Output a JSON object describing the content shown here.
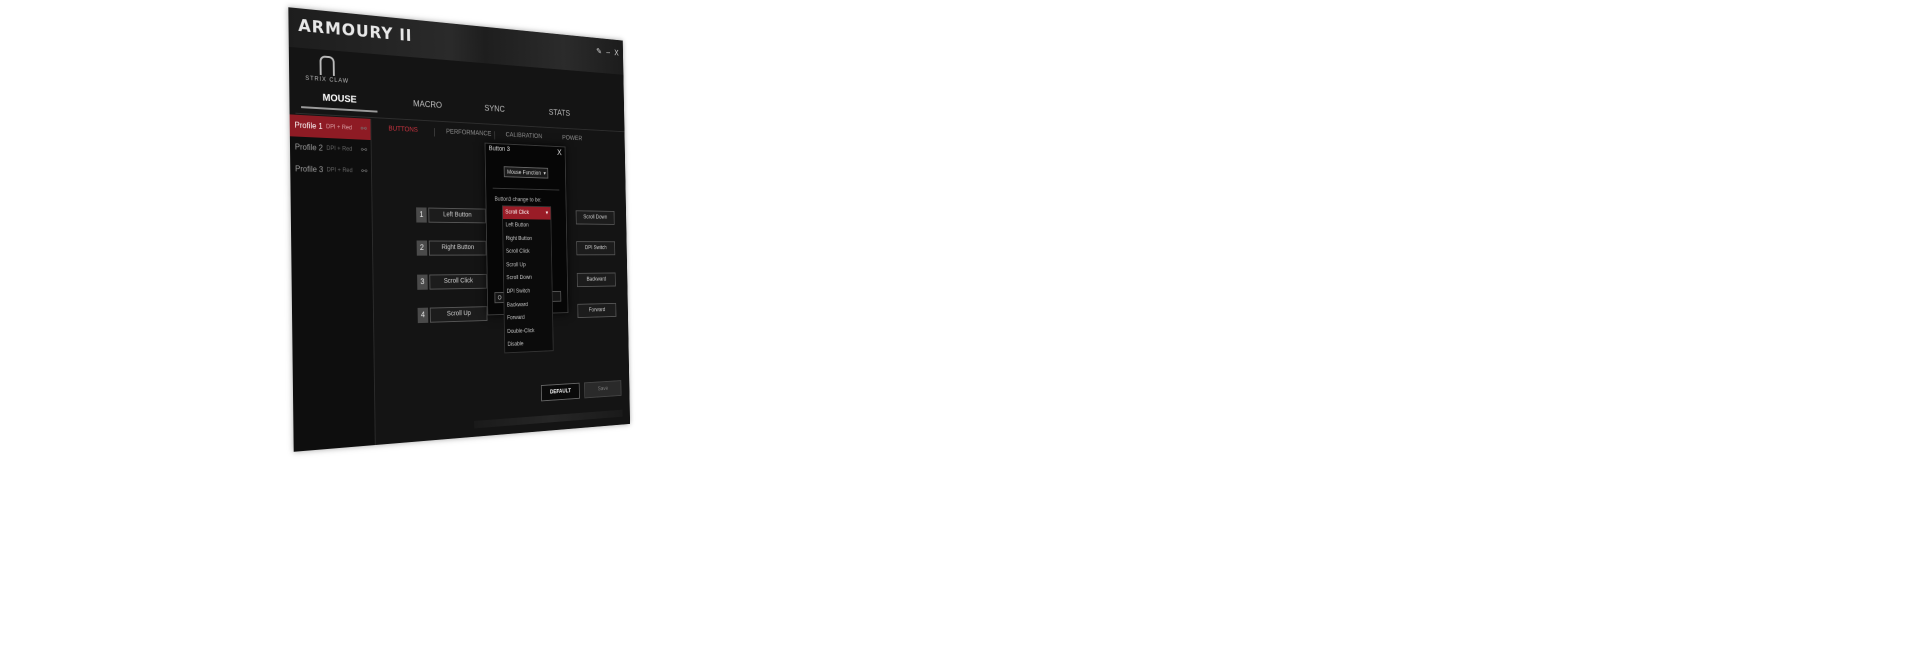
{
  "window": {
    "title": "ARMOURY II",
    "controls": {
      "settings": "✎",
      "minimize": "–",
      "close": "X"
    }
  },
  "brand": {
    "name": "STRIX CLAW"
  },
  "main_tabs": [
    {
      "label": "MOUSE"
    },
    {
      "label": "MACRO"
    },
    {
      "label": "SYNC"
    },
    {
      "label": "STATS"
    }
  ],
  "profiles": [
    {
      "label": "Profile 1",
      "dpi": "DPI + Red"
    },
    {
      "label": "Profile 2",
      "dpi": "DPI + Red"
    },
    {
      "label": "Profile 3",
      "dpi": "DPI + Red"
    }
  ],
  "sub_tabs": [
    {
      "label": "BUTTONS"
    },
    {
      "label": "PERFORMANCE"
    },
    {
      "label": "CALIBRATION"
    },
    {
      "label": "POWER"
    }
  ],
  "left_buttons": [
    {
      "num": "1",
      "label": "Left Button"
    },
    {
      "num": "2",
      "label": "Right Button"
    },
    {
      "num": "3",
      "label": "Scroll Click"
    },
    {
      "num": "4",
      "label": "Scroll Up"
    }
  ],
  "right_buttons": [
    {
      "label": "Scroll Down"
    },
    {
      "label": "DPI Switch"
    },
    {
      "label": "Backward"
    },
    {
      "label": "Forward"
    }
  ],
  "dialog": {
    "title": "Button 3",
    "close": "X",
    "function_select": "Mouse Function",
    "change_label": "Button3 change to be:",
    "ok": "O"
  },
  "dropdown": {
    "selected": "Scroll Click",
    "options": [
      "Left Button",
      "Right Button",
      "Scroll Click",
      "Scroll Up",
      "Scroll Down",
      "DPI Switch",
      "Backward",
      "Forward",
      "Double-Click",
      "Disable"
    ]
  },
  "footer": {
    "default": "DEFAULT",
    "save": "Save"
  },
  "colors": {
    "accent": "#8e1b24",
    "background": "#141414"
  }
}
